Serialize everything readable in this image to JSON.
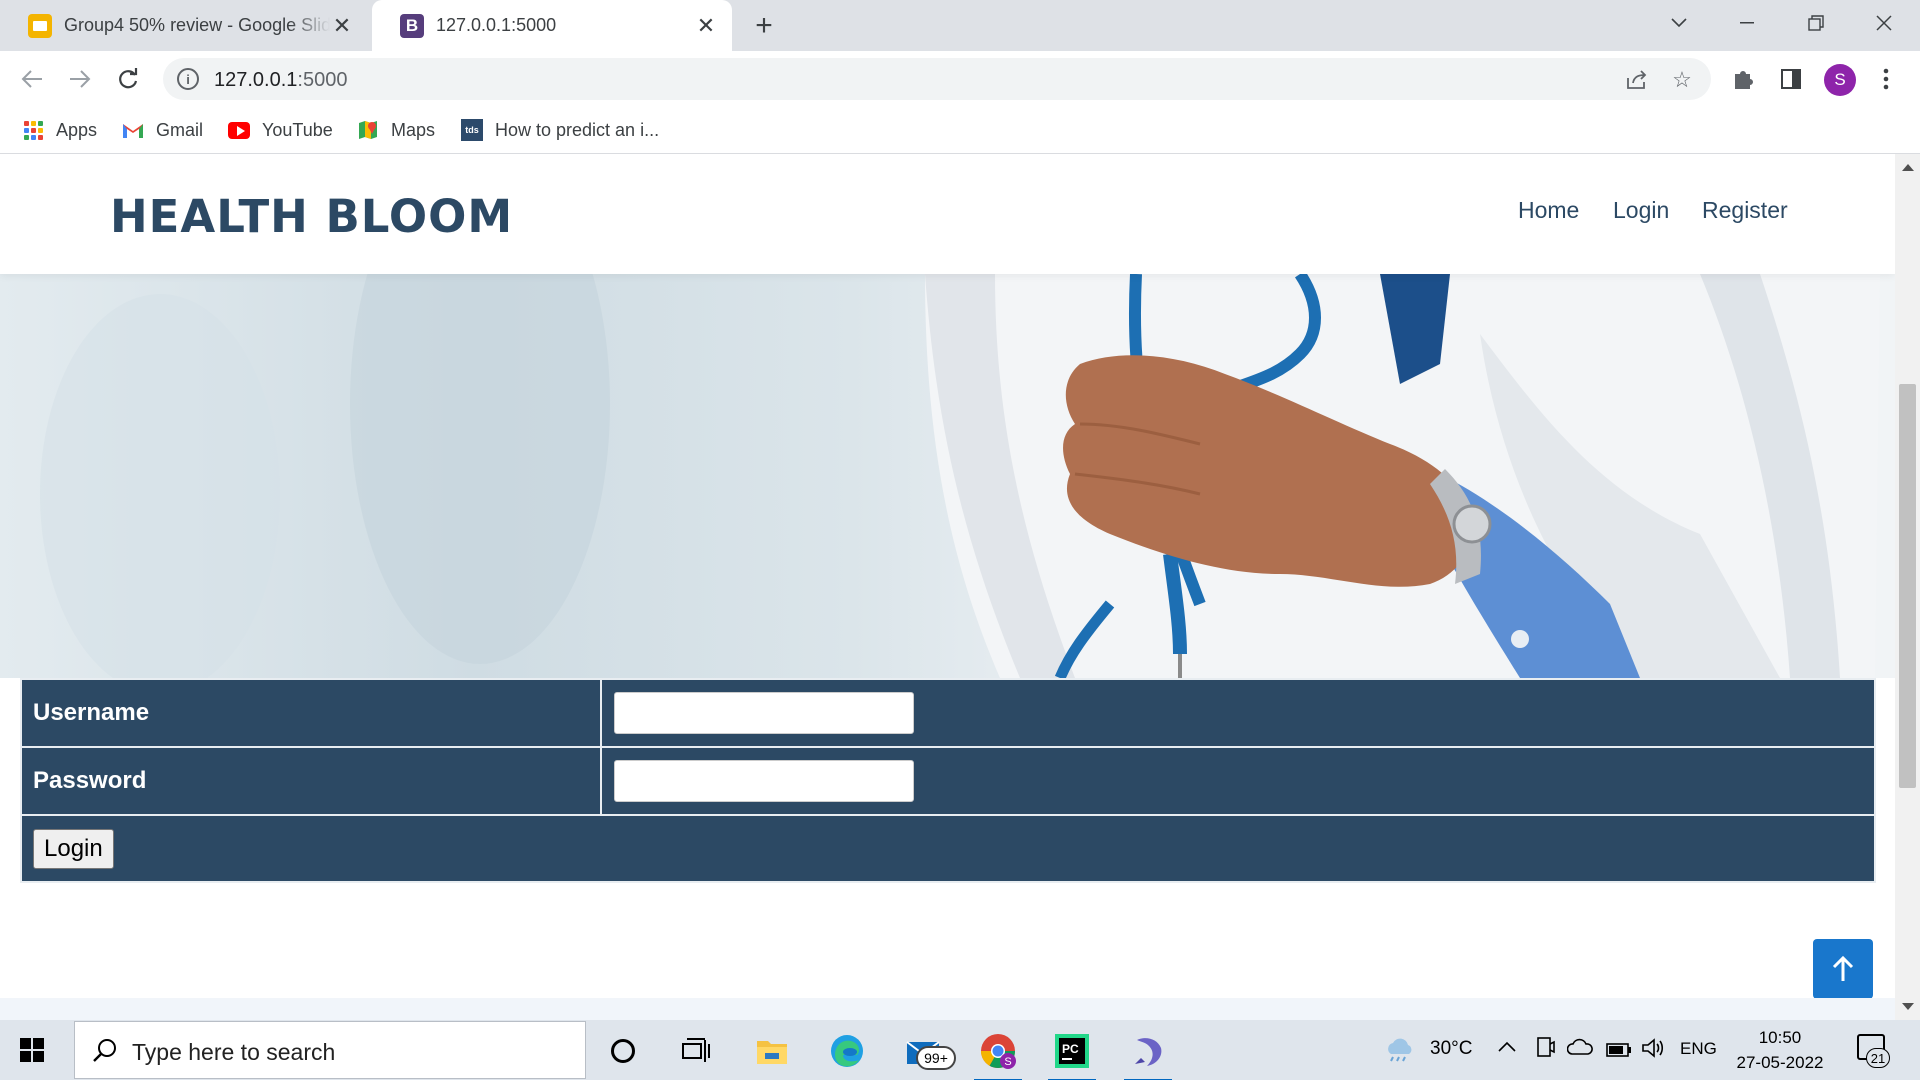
{
  "browser": {
    "tabs": [
      {
        "title": "Group4 50% review - Google Slides",
        "favicon": "google-slides-icon"
      },
      {
        "title": "127.0.0.1:5000",
        "favicon": "bootstrap-icon"
      }
    ],
    "address_bar": {
      "host": "127.0.0.1",
      "port": ":5000"
    },
    "profile_initial": "S",
    "bookmarks": [
      {
        "label": "Apps",
        "icon": "apps-grid-icon"
      },
      {
        "label": "Gmail",
        "icon": "gmail-icon"
      },
      {
        "label": "YouTube",
        "icon": "youtube-icon"
      },
      {
        "label": "Maps",
        "icon": "maps-icon"
      },
      {
        "label": "How to predict an i...",
        "icon": "tds-icon"
      }
    ]
  },
  "site": {
    "logo": "HEALTH BLOOM",
    "nav": [
      {
        "label": "Home"
      },
      {
        "label": "Login"
      },
      {
        "label": "Register"
      }
    ],
    "form": {
      "username_label": "Username",
      "password_label": "Password",
      "submit_label": "Login"
    }
  },
  "taskbar": {
    "search_placeholder": "Type here to search",
    "mail_badge": "99+",
    "weather": "30°C",
    "language": "ENG",
    "time": "10:50",
    "date": "27-05-2022",
    "notification_count": "21"
  },
  "colors": {
    "brand_navy": "#2c4964",
    "accent_blue": "#1977cc",
    "chrome_tabstrip": "#dee1e6"
  }
}
